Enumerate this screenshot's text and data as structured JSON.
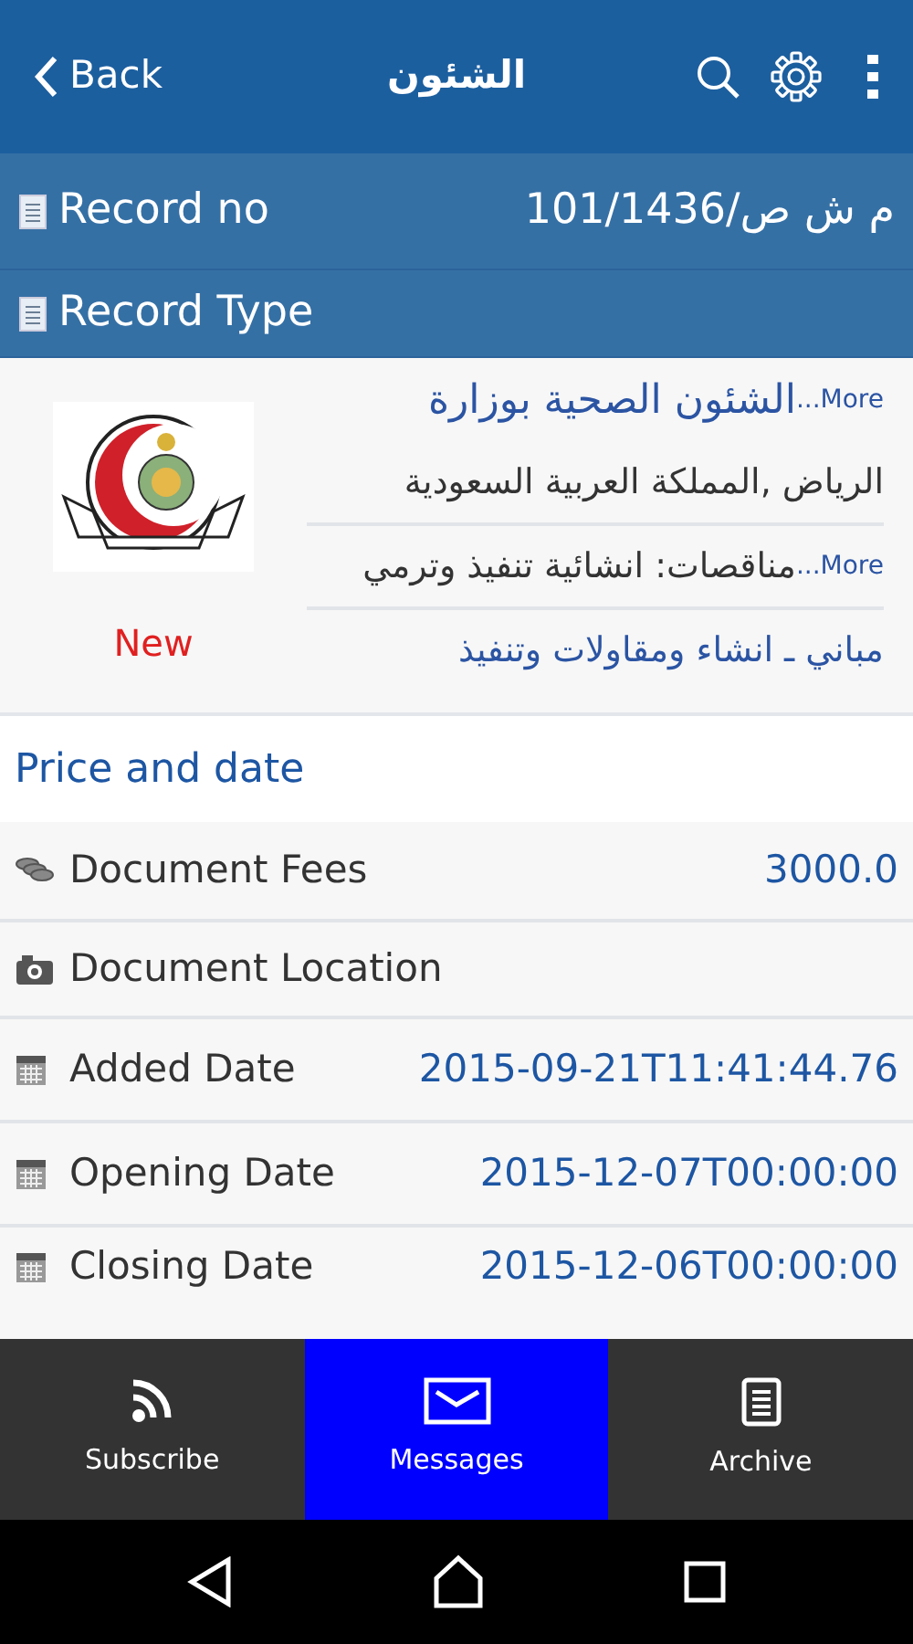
{
  "header": {
    "back": "Back",
    "title": "الشئون"
  },
  "record_rows": [
    {
      "label": "Record no",
      "value": "م ش ص/101/1436"
    },
    {
      "label": "Record Type",
      "value": ""
    }
  ],
  "card": {
    "badge": "New",
    "lines": [
      {
        "kind": "link",
        "text": "الشئون الصحية بوزارة",
        "more": "...More"
      },
      {
        "kind": "plain",
        "text": "الرياض ,المملكة العربية السعودية"
      },
      {
        "kind": "more",
        "text": "مناقصات: انشائية تنفيذ وترمي",
        "more": "...More"
      },
      {
        "kind": "link",
        "text": "مباني ـ انشاء ومقاولات وتنفيذ"
      }
    ]
  },
  "section_title": "Price and date",
  "detail_rows": [
    {
      "kind": "money",
      "label": "Document Fees",
      "value": "3000.0"
    },
    {
      "kind": "camera",
      "label": "Document Location"
    },
    {
      "kind": "calendar",
      "label": "Added Date",
      "value": "2015-09-21T11:41:44.76"
    },
    {
      "kind": "calendar",
      "label": "Opening Date",
      "value": "2015-12-07T00:00:00"
    },
    {
      "kind": "calendar",
      "label": "Closing Date",
      "value": "2015-12-06T00:00:00"
    }
  ],
  "tabs": [
    {
      "kind": "rss",
      "label": "Subscribe",
      "selected": false
    },
    {
      "kind": "mail",
      "label": "Messages",
      "selected": true
    },
    {
      "kind": "doc",
      "label": "Archive",
      "selected": false
    }
  ]
}
